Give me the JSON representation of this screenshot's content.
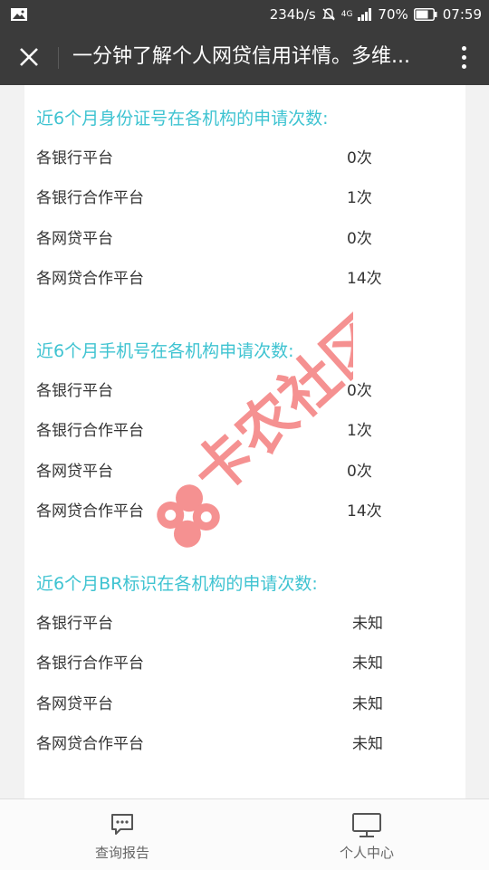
{
  "status_bar": {
    "net_speed": "234b/s",
    "network": "4G",
    "battery": "70%",
    "time": "07:59"
  },
  "title_bar": {
    "title": "一分钟了解个人网贷信用详情。多维..."
  },
  "sections": [
    {
      "heading": "近6个月身份证号在各机构的申请次数:",
      "rows": [
        {
          "label": "各银行平台",
          "value": "0次"
        },
        {
          "label": "各银行合作平台",
          "value": "1次"
        },
        {
          "label": "各网贷平台",
          "value": "0次"
        },
        {
          "label": "各网贷合作平台",
          "value": "14次"
        }
      ]
    },
    {
      "heading": "近6个月手机号在各机构申请次数:",
      "rows": [
        {
          "label": "各银行平台",
          "value": "0次"
        },
        {
          "label": "各银行合作平台",
          "value": "1次"
        },
        {
          "label": "各网贷平台",
          "value": "0次"
        },
        {
          "label": "各网贷合作平台",
          "value": "14次"
        }
      ]
    },
    {
      "heading": "近6个月BR标识在各机构的申请次数:",
      "rows": [
        {
          "label": "各银行平台",
          "value": "未知"
        },
        {
          "label": "各银行合作平台",
          "value": "未知"
        },
        {
          "label": "各网贷平台",
          "value": "未知"
        },
        {
          "label": "各网贷合作平台",
          "value": "未知"
        }
      ]
    }
  ],
  "watermark": {
    "text": "卡农社区"
  },
  "bottom_nav": [
    {
      "label": "查询报告",
      "icon": "message-icon"
    },
    {
      "label": "个人中心",
      "icon": "monitor-icon"
    }
  ],
  "colors": {
    "accent": "#3ec3d1",
    "bar": "#3b3b3b",
    "watermark": "#f26d6d"
  }
}
